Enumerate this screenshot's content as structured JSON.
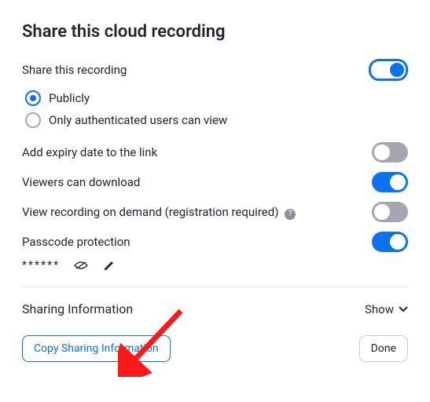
{
  "title": "Share this cloud recording",
  "share_label": "Share this recording",
  "share_on": true,
  "radios": {
    "public": "Publicly",
    "auth": "Only authenticated users can view",
    "selected": "public"
  },
  "rows": {
    "expiry": {
      "label": "Add expiry date to the link",
      "on": false
    },
    "download": {
      "label": "Viewers can download",
      "on": true
    },
    "ondemand": {
      "label": "View recording on demand (registration required)",
      "on": false
    },
    "passcode": {
      "label": "Passcode protection",
      "on": true
    }
  },
  "passcode_mask": "******",
  "sharing_info_label": "Sharing Information",
  "show_label": "Show",
  "buttons": {
    "copy": "Copy Sharing Information",
    "done": "Done"
  }
}
